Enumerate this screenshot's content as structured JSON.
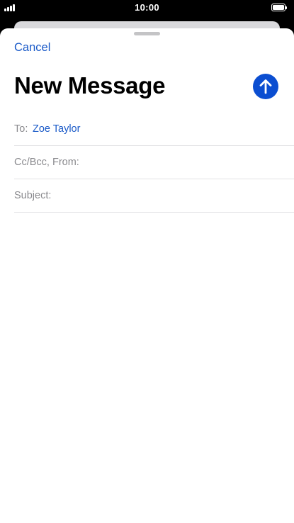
{
  "status_bar": {
    "time": "10:00",
    "signal_icon": "cellular-signal-icon",
    "battery_icon": "battery-full-icon"
  },
  "sheet": {
    "cancel_label": "Cancel",
    "title": "New Message",
    "send_icon": "arrow-up-icon"
  },
  "fields": {
    "to": {
      "label": "To:",
      "value": "Zoe Taylor"
    },
    "cc_from": {
      "label": "Cc/Bcc, From:"
    },
    "subject": {
      "label": "Subject:"
    }
  },
  "colors": {
    "accent": "#1a5ac8",
    "send_button": "#0b4ed1",
    "label_gray": "#8a8a8e",
    "separator": "#e1e1e4"
  }
}
